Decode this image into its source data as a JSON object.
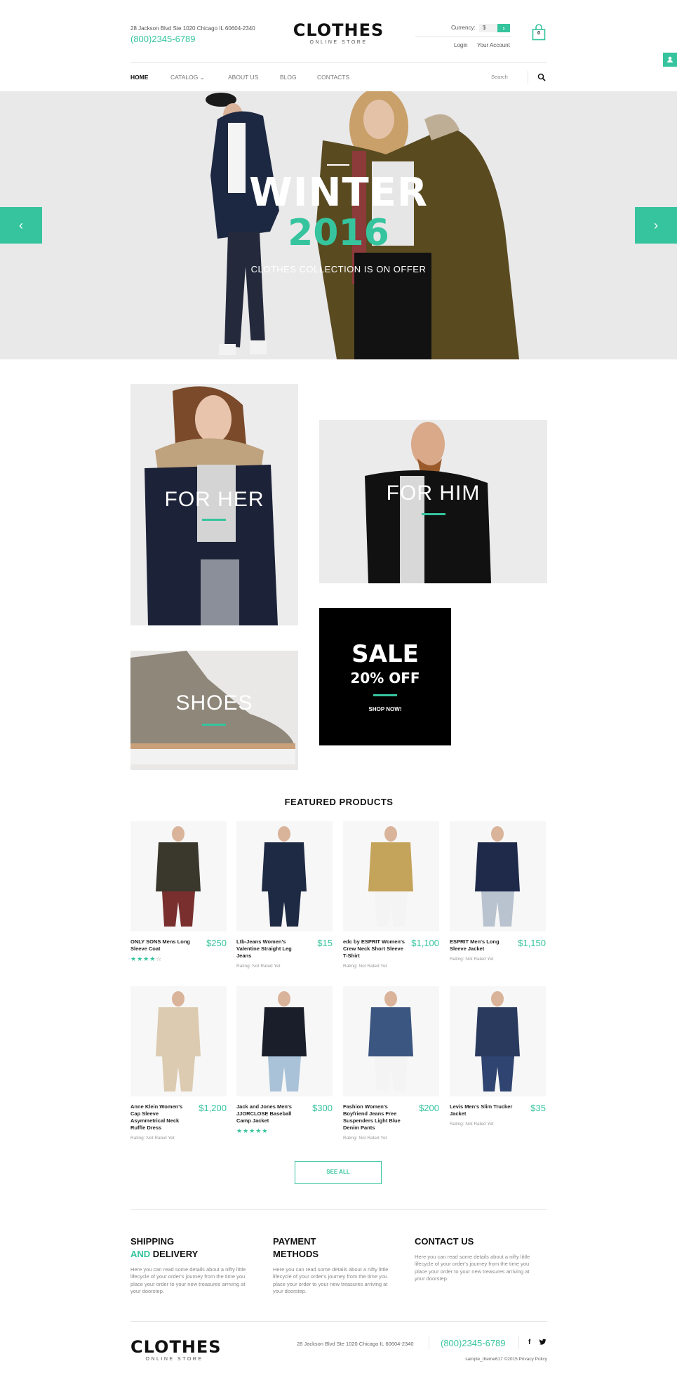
{
  "header": {
    "address": "28 Jackson Blvd Ste 1020 Chicago IL 60604-2340",
    "phone": "(800)2345-6789",
    "logo_main": "CLOTHES",
    "logo_sub": "ONLINE STORE",
    "currency_label": "Currency:",
    "currency_value": "$",
    "currency_go": "›",
    "login": "Login",
    "account": "Your Account",
    "cart_count": "0"
  },
  "nav": {
    "items": [
      {
        "label": "HOME",
        "active": true
      },
      {
        "label": "CATALOG ⌄",
        "active": false
      },
      {
        "label": "ABOUT US",
        "active": false
      },
      {
        "label": "BLOG",
        "active": false
      },
      {
        "label": "CONTACTS",
        "active": false
      }
    ],
    "search_placeholder": "Search"
  },
  "hero": {
    "title": "WINTER",
    "year": "2016",
    "subtitle": "CLOTHES COLLECTION IS ON OFFER",
    "prev": "‹",
    "next": "›"
  },
  "banners": {
    "her": "FOR HER",
    "him": "FOR HIM",
    "shoes": "SHOES",
    "sale_title": "SALE",
    "sale_sub": "20% OFF",
    "sale_link": "SHOP NOW!"
  },
  "featured": {
    "title": "FEATURED PRODUCTS",
    "products": [
      {
        "name": "ONLY SONS Mens Long Sleeve Coat",
        "price": "$250",
        "rating": null,
        "stars": 4
      },
      {
        "name": "Ltb-Jeans Women's Valentine Straight Leg Jeans",
        "price": "$15",
        "rating": "Rating: Not Rated Yet",
        "stars": null
      },
      {
        "name": "edc by ESPRIT Women's Crew Neck Short Sleeve T-Shirt",
        "price": "$1,100",
        "rating": "Rating: Not Rated Yet",
        "stars": null
      },
      {
        "name": "ESPRIT Men's Long Sleeve Jacket",
        "price": "$1,150",
        "rating": "Rating: Not Rated Yet",
        "stars": null
      },
      {
        "name": "Anne Klein Women's Cap Sleeve Asymmetrical Neck Ruffle Dress",
        "price": "$1,200",
        "rating": "Rating: Not Rated Yet",
        "stars": null
      },
      {
        "name": "Jack and Jones Men's JJORCLOSE Baseball Camp Jacket",
        "price": "$300",
        "rating": null,
        "stars": 5
      },
      {
        "name": "Fashion Women's Boyfriend Jeans Free Suspenders Light Blue Denim Pants",
        "price": "$200",
        "rating": "Rating: Not Rated Yet",
        "stars": null
      },
      {
        "name": "Levis Men's Slim Trucker Jacket",
        "price": "$35",
        "rating": "Rating: Not Rated Yet",
        "stars": null
      }
    ],
    "see_all": "SEE ALL"
  },
  "info": [
    {
      "title_line1": "SHIPPING",
      "title_accent": "AND",
      "title_rest": " DELIVERY",
      "text": "Here you can read some details about a nifty little lifecycle of your order's journey from the time you place your order to your new treasures arriving at your doorstep."
    },
    {
      "title_line1": "PAYMENT",
      "title_accent": "",
      "title_rest": "METHODS",
      "text": "Here you can read some details about a nifty little lifecycle of your order's journey from the time you place your order to your new treasures arriving at your doorstep."
    },
    {
      "title_line1": "CONTACT US",
      "title_accent": "",
      "title_rest": "",
      "text": "Here you can read some details about a nifty little lifecycle of your order's journey from the time you place your order to your new treasures arriving at your doorstep."
    }
  ],
  "footer": {
    "logo_main": "CLOTHES",
    "logo_sub": "ONLINE STORE",
    "address": "28 Jackson Blvd Ste 1020 Chicago IL 60604-2340",
    "phone": "(800)2345-6789",
    "facebook": "f",
    "copyright": "sample_theme617 ©2015 Privacy Policy"
  },
  "colors": {
    "accent": "#35c49d",
    "dark": "#111111",
    "hero_bg": "#e9e9ea"
  }
}
